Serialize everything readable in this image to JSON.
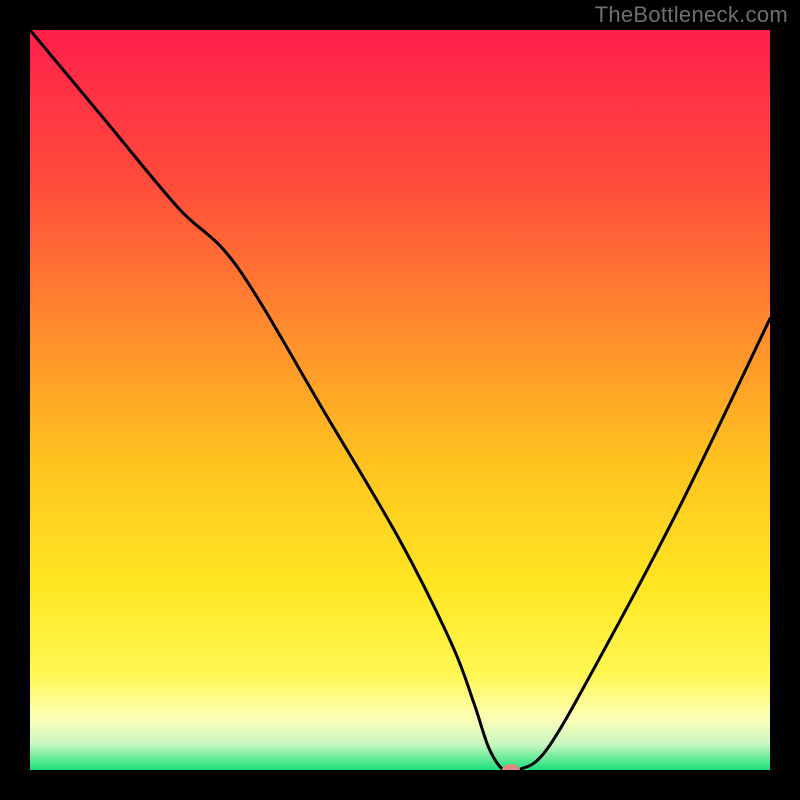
{
  "watermark": "TheBottleneck.com",
  "chart_data": {
    "type": "line",
    "title": "",
    "xlabel": "",
    "ylabel": "",
    "xlim": [
      0,
      100
    ],
    "ylim": [
      0,
      100
    ],
    "grid": false,
    "legend": false,
    "series": [
      {
        "name": "curve",
        "x": [
          0,
          10,
          20,
          28,
          40,
          50,
          57,
          60,
          62,
          64,
          66,
          70,
          78,
          88,
          100
        ],
        "y": [
          100,
          88,
          76,
          68,
          48,
          31,
          17,
          9,
          3,
          0,
          0,
          3,
          17,
          36,
          61
        ]
      }
    ],
    "marker": {
      "x": 65,
      "y": 0,
      "color": "#d98b82",
      "rx": 9,
      "ry": 6
    },
    "background_gradient": {
      "stops": [
        {
          "offset": 0.0,
          "color": "#ff1f4b"
        },
        {
          "offset": 0.2,
          "color": "#ff4a3c"
        },
        {
          "offset": 0.4,
          "color": "#ff8a2e"
        },
        {
          "offset": 0.58,
          "color": "#ffc21f"
        },
        {
          "offset": 0.75,
          "color": "#ffe623"
        },
        {
          "offset": 0.87,
          "color": "#fff752"
        },
        {
          "offset": 0.93,
          "color": "#fdffb8"
        },
        {
          "offset": 0.965,
          "color": "#c8f7bf"
        },
        {
          "offset": 1.0,
          "color": "#19e07a"
        }
      ]
    },
    "line_color": "#000000",
    "line_width": 3
  }
}
